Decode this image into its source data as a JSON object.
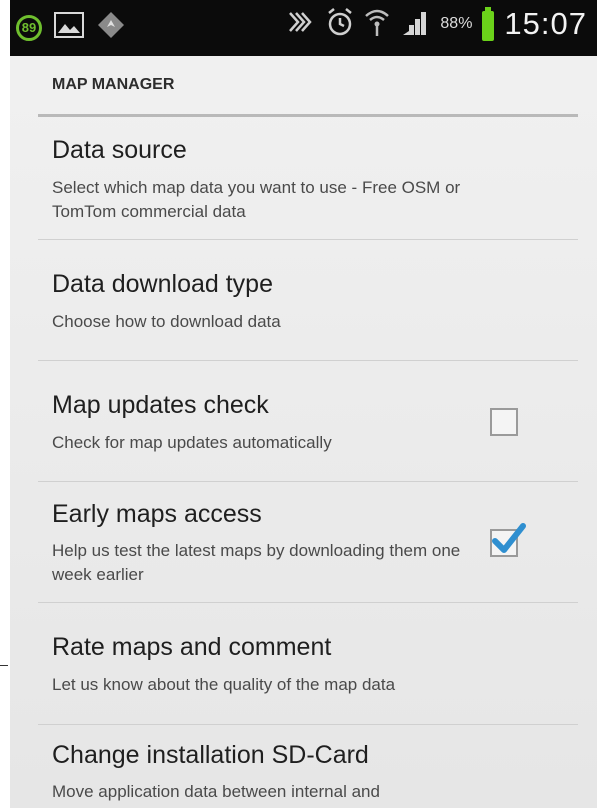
{
  "status_bar": {
    "notification_count": "89",
    "icons": [
      "image-icon",
      "navigation-icon",
      "nfc-icon",
      "alarm-icon",
      "wifi-icon",
      "signal-icon"
    ],
    "battery_percent": "88%",
    "time": "15:07",
    "battery_color": "#6bd21a",
    "badge_color": "#6fbf2e"
  },
  "section": {
    "header": "MAP MANAGER"
  },
  "items": [
    {
      "title": "Data source",
      "summary": "Select which map data you want to use - Free OSM or TomTom commercial data"
    },
    {
      "title": "Data download type",
      "summary": "Choose how to download data"
    },
    {
      "title": "Map updates check",
      "summary": "Check for map updates automatically",
      "checked": false
    },
    {
      "title": "Early maps access",
      "summary": "Help us test the latest maps by downloading them one week earlier",
      "checked": true
    },
    {
      "title": "Rate maps and comment",
      "summary": "Let us know about the quality of the map data"
    },
    {
      "title": "Change installation SD-Card",
      "summary": "Move application data between internal and"
    }
  ],
  "colors": {
    "checkmark": "#2f8fd0"
  }
}
